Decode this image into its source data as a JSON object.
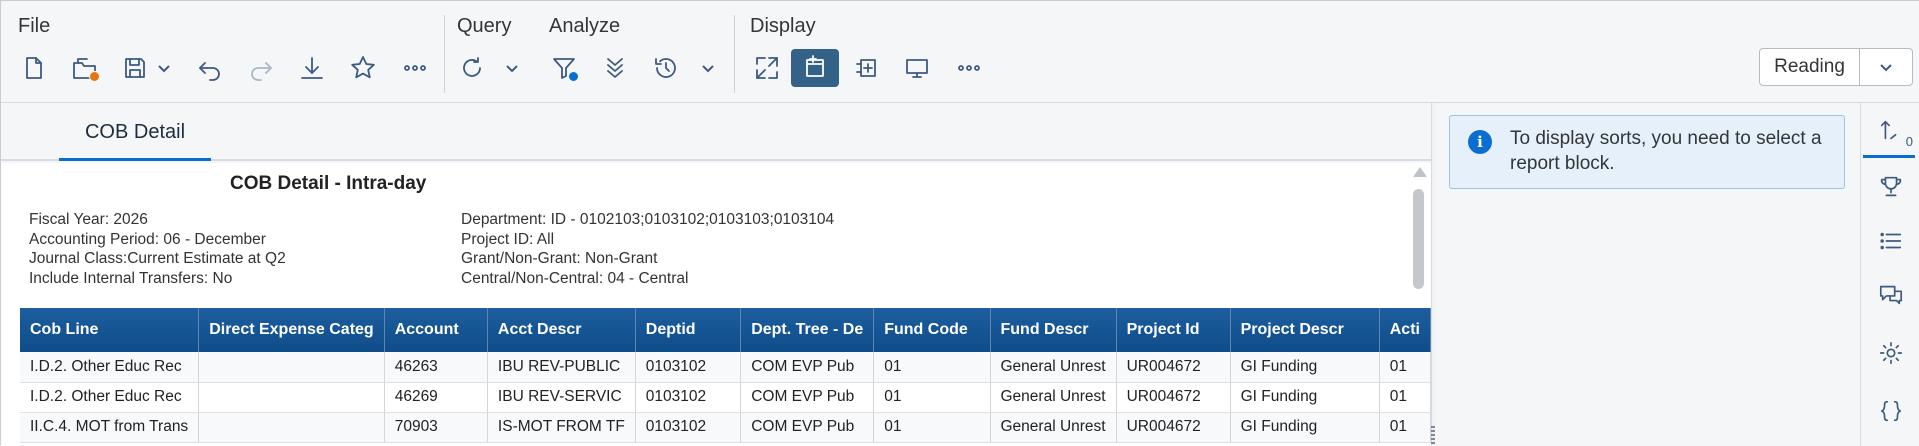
{
  "toolbar": {
    "groups": {
      "file": "File",
      "query": "Query",
      "analyze": "Analyze",
      "display": "Display"
    },
    "file_buttons": [
      "new-document-icon",
      "open-folder-icon",
      "save-icon",
      "undo-icon",
      "redo-icon",
      "download-icon",
      "favorite-star-icon",
      "more-icon"
    ],
    "query_buttons": [
      "refresh-icon"
    ],
    "analyze_buttons": [
      "filter-icon",
      "drill-icon",
      "history-icon"
    ],
    "display_buttons": [
      "fit-page-icon",
      "structure-mode-icon",
      "insert-block-icon",
      "monitor-icon",
      "more-icon"
    ],
    "reading_mode": "Reading",
    "colors": {
      "accent": "#0a6ed1",
      "active_button": "#346187",
      "header_blue": "#0f4c8a",
      "notification_orange": "#e9730c"
    }
  },
  "tabs": [
    {
      "label": "COB Detail",
      "selected": true
    }
  ],
  "report": {
    "title": "COB Detail - Intra-day",
    "filters_left": [
      "Fiscal Year: 2026",
      "Accounting Period: 06 - December",
      "Journal Class:Current Estimate at Q2",
      "Include Internal Transfers: No"
    ],
    "filters_right": [
      "Department: ID - 0102103;0103102;0103103;0103104",
      "Project ID: All",
      "Grant/Non-Grant: Non-Grant",
      "Central/Non-Central: 04 - Central"
    ],
    "columns": [
      "Cob Line",
      "Direct Expense Categ",
      "Account",
      "Acct Descr",
      "Deptid",
      "Dept. Tree - De",
      "Fund Code",
      "Fund Descr",
      "Project Id",
      "Project Descr",
      "Acti"
    ],
    "rows": [
      [
        "I.D.2. Other Educ Rec",
        "",
        "46263",
        "IBU REV-PUBLIC",
        "0103102",
        "COM EVP Pub",
        "01",
        "General Unrest",
        "UR004672",
        "GI Funding",
        "01"
      ],
      [
        "I.D.2. Other Educ Rec",
        "",
        "46269",
        "IBU REV-SERVIC",
        "0103102",
        "COM EVP Pub",
        "01",
        "General Unrest",
        "UR004672",
        "GI Funding",
        "01"
      ],
      [
        "II.C.4. MOT from Trans",
        "",
        "70903",
        "IS-MOT FROM TF",
        "0103102",
        "COM EVP Pub",
        "01",
        "General Unrest",
        "UR004672",
        "GI Funding",
        "01"
      ]
    ]
  },
  "side_panel": {
    "info_message": "To display sorts, you need to select a report block.",
    "sort_count": "0"
  },
  "rail": [
    "sort-icon",
    "ranking-trophy-icon",
    "list-icon",
    "comments-icon",
    "settings-icon",
    "code-braces-icon"
  ]
}
